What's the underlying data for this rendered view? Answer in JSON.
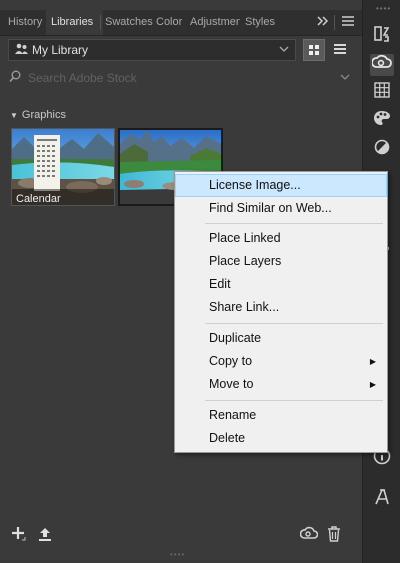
{
  "tabs": [
    {
      "label": "History",
      "active": false
    },
    {
      "label": "Libraries",
      "active": true
    },
    {
      "label": "Swatches",
      "active": false
    },
    {
      "label": "Color",
      "active": false
    },
    {
      "label": "Adjustmen",
      "active": false
    },
    {
      "label": "Styles",
      "active": false
    }
  ],
  "tab_controls": {
    "overflow_icon": "double-chevron-right-icon",
    "menu_icon": "hamburger-icon"
  },
  "library": {
    "name": "My Library",
    "icon": "user-library-icon"
  },
  "view_modes": {
    "grid": "grid-view-icon",
    "list": "list-view-icon",
    "active": "grid"
  },
  "search": {
    "placeholder": "Search Adobe Stock"
  },
  "group": {
    "title": "Graphics",
    "expanded": true
  },
  "assets": [
    {
      "label": "Calendar",
      "icon": "calendar-thumbnail"
    },
    {
      "label": "",
      "icon": "landscape-thumbnail"
    }
  ],
  "bottom_bar": {
    "left": [
      "add-icon",
      "upload-icon"
    ],
    "right": [
      "creative-cloud-icon",
      "trash-icon"
    ]
  },
  "right_rail": [
    "paragraph-styles-icon",
    "creative-cloud-libraries-icon",
    "grid-icon",
    "palette-icon",
    "contrast-icon",
    "layers-icon",
    "adjust-icon",
    "flow-icon",
    "info-icon",
    "type-icon"
  ],
  "context_menu": {
    "groups": [
      [
        {
          "label": "License Image...",
          "highlighted": true
        },
        {
          "label": "Find Similar on Web...",
          "highlighted": false
        }
      ],
      [
        {
          "label": "Place Linked"
        },
        {
          "label": "Place Layers"
        },
        {
          "label": "Edit"
        },
        {
          "label": "Share Link..."
        }
      ],
      [
        {
          "label": "Duplicate"
        },
        {
          "label": "Copy to",
          "submenu": true
        },
        {
          "label": "Move to",
          "submenu": true
        }
      ],
      [
        {
          "label": "Rename"
        },
        {
          "label": "Delete"
        }
      ]
    ]
  },
  "colors": {
    "panel": "#3a3a3a",
    "menu_bg": "#f0f0f0",
    "highlight": "#cce8ff"
  }
}
